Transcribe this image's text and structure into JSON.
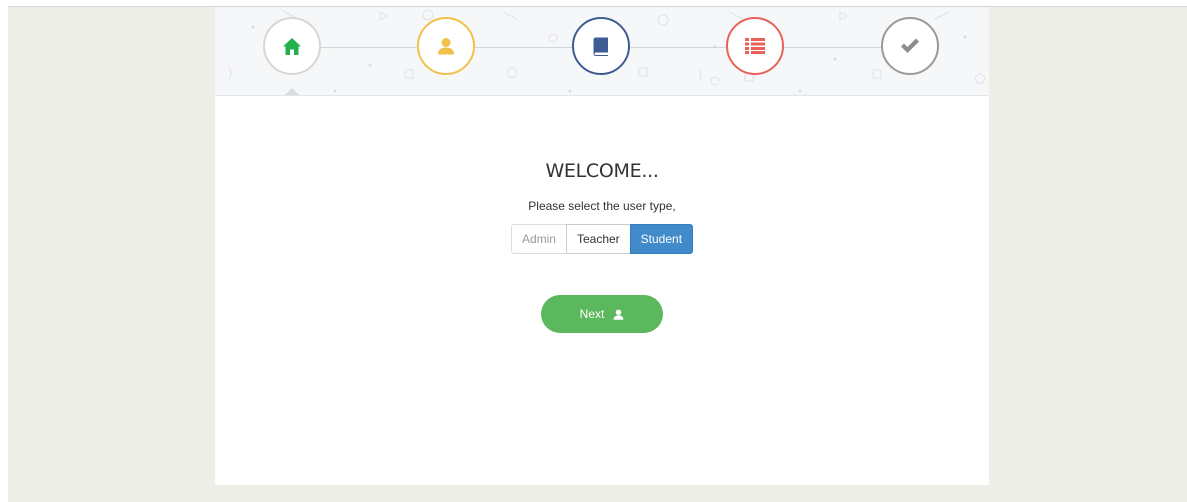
{
  "wizard": {
    "steps": [
      {
        "icon": "home-icon",
        "color": "#22b14c"
      },
      {
        "icon": "user-icon",
        "color": "#f1c24a"
      },
      {
        "icon": "book-icon",
        "color": "#3e5c93"
      },
      {
        "icon": "list-icon",
        "color": "#e9625a"
      },
      {
        "icon": "check-icon",
        "color": "#9a9a9a"
      }
    ],
    "active_step": 1
  },
  "main": {
    "title": "WELCOME...",
    "subtitle": "Please select the user type,",
    "user_types": [
      {
        "label": "Admin",
        "selected": false
      },
      {
        "label": "Teacher",
        "selected": false
      },
      {
        "label": "Student",
        "selected": true
      }
    ],
    "next_label": "Next",
    "next_icon": "user-icon"
  },
  "colors": {
    "page_background": "#eeeee9",
    "selected_accent": "#428bca",
    "next_button": "#5cb85c"
  }
}
